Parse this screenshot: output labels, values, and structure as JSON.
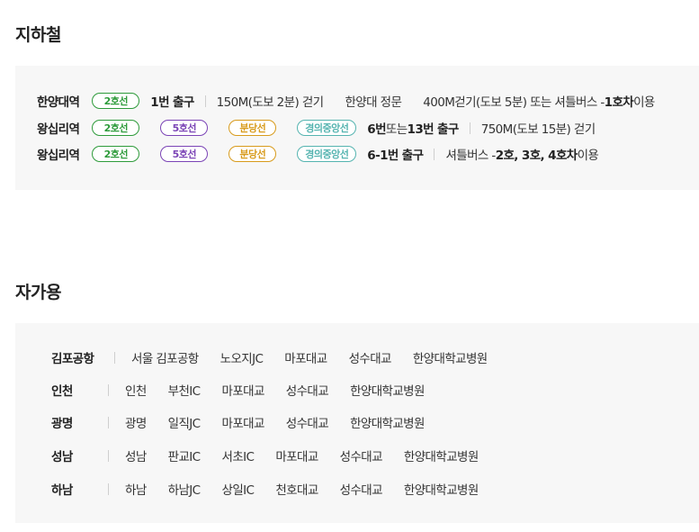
{
  "subway": {
    "title": "지하철",
    "rows": [
      {
        "station": "한양대역",
        "lines": [
          "2호선"
        ],
        "exit": "1번 출구",
        "walk": "150M(도보 2분) 걷기",
        "gate": "한양대 정문",
        "alt_walk": "400M걷기(도보 5분) 또는 셔틀버스 - ",
        "alt_bus": "1호차",
        "alt_suffix": " 이용"
      },
      {
        "station": "왕십리역",
        "lines": [
          "2호선",
          "5호선",
          "분당선",
          "경의중앙선"
        ],
        "exit_a": "6번",
        "exit_or": " 또는 ",
        "exit_b": "13번 출구",
        "walk": "750M(도보 15분) 걷기"
      },
      {
        "station": "왕십리역",
        "lines": [
          "2호선",
          "5호선",
          "분당선",
          "경의중앙선"
        ],
        "exit": "6-1번 출구",
        "shuttle": "셔틀버스 - ",
        "shuttle_bus": "2호, 3호, 4호차",
        "shuttle_suffix": " 이용"
      }
    ]
  },
  "car": {
    "title": "자가용",
    "rows": [
      {
        "origin": "김포공항",
        "stops": [
          "서울 김포공항",
          "노오지JC",
          "마포대교",
          "성수대교",
          "한양대학교병원"
        ]
      },
      {
        "origin": "인천",
        "stops": [
          "인천",
          "부천IC",
          "마포대교",
          "성수대교",
          "한양대학교병원"
        ]
      },
      {
        "origin": "광명",
        "stops": [
          "광명",
          "일직JC",
          "마포대교",
          "성수대교",
          "한양대학교병원"
        ]
      },
      {
        "origin": "성남",
        "stops": [
          "성남",
          "판교IC",
          "서초IC",
          "마포대교",
          "성수대교",
          "한양대학교병원"
        ]
      },
      {
        "origin": "하남",
        "stops": [
          "하남",
          "하남JC",
          "상일IC",
          "천호대교",
          "성수대교",
          "한양대학교병원"
        ]
      }
    ]
  },
  "colors": {
    "line_2": "#2e9b3b",
    "line_5": "#7b44b6",
    "line_bundang": "#d89b1c",
    "line_gyeongui": "#55b4b0",
    "panel_bg": "#f7f7f7"
  }
}
